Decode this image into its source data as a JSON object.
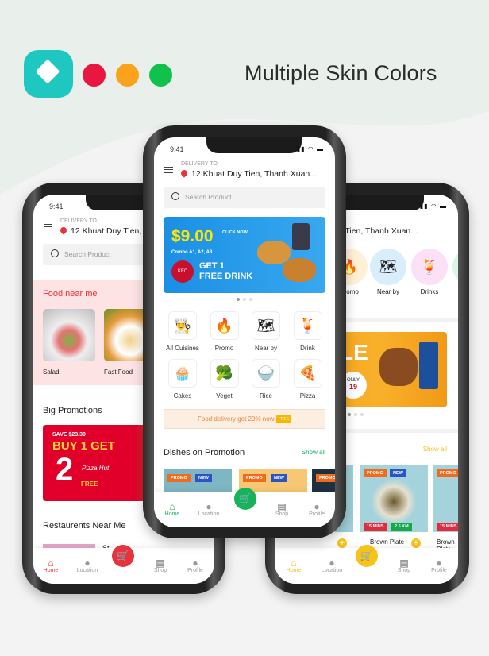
{
  "header": {
    "title": "Multiple Skin Colors",
    "logo_icon": "paint-bucket-icon",
    "skin_colors": [
      "#e8173f",
      "#fba21d",
      "#10c14c"
    ],
    "logo_color": "#1ec8c0"
  },
  "common": {
    "time": "9:41",
    "delivery_label": "DELIVERY TO",
    "address": "12 Khuat Duy Tien, Thanh Xuan...",
    "address_left": "12 Khuat Duy Tien, Th",
    "search_placeholder": "Search Product",
    "nav": [
      "Home",
      "Location",
      "Shop",
      "Profile"
    ]
  },
  "left_phone": {
    "accent": "#e8323c",
    "food_near_me": "Food near me",
    "foods": [
      "Salad",
      "Fast Food"
    ],
    "big_promotions": "Big Promotions",
    "promo_banner": {
      "save": "SAVE $23.30",
      "headline": "BUY 1 GET",
      "number": "2",
      "free": "FREE",
      "brand": "Pizza Hut"
    },
    "restaurants": "Restaurents Near Me",
    "restaurant_partial": "St"
  },
  "middle_phone": {
    "accent": "#16b35a",
    "banner": {
      "price": "$9.00",
      "cta": "CLICK NOW",
      "combo": "Combo A1, A2, A3",
      "offer1": "GET 1",
      "offer2": "FREE DRINK",
      "brand": "KFC"
    },
    "categories": [
      {
        "label": "All Cuisines",
        "icon": "👨‍🍳"
      },
      {
        "label": "Promo",
        "icon": "🔥"
      },
      {
        "label": "Near by",
        "icon": "🗺"
      },
      {
        "label": "Drink",
        "icon": "🍹"
      },
      {
        "label": "Cakes",
        "icon": "🧁"
      },
      {
        "label": "Veget",
        "icon": "🥦"
      },
      {
        "label": "Rice",
        "icon": "🍚"
      },
      {
        "label": "Pizza",
        "icon": "🍕"
      }
    ],
    "promo_strip": "Food delivery get 20% now",
    "promo_strip_badge": "FREE",
    "dishes_title": "Dishes on Promotion",
    "show_all": "Show all",
    "tag_promo": "PROMO",
    "tag_new": "NEW"
  },
  "right_phone": {
    "accent": "#f7c21a",
    "categories": [
      {
        "label": "Promo",
        "icon": "🔥"
      },
      {
        "label": "Near by",
        "icon": "🗺"
      },
      {
        "label": "Drinks",
        "icon": "🍹"
      }
    ],
    "banner": {
      "text": "LE",
      "only": "ONLY",
      "price": "19"
    },
    "show_all": "Show all",
    "tag_promo": "PROMO",
    "tag_new": "NEW",
    "tag_time": "15 MINS",
    "tag_dist": "2.5 KM",
    "dish": "Brown Plate"
  }
}
